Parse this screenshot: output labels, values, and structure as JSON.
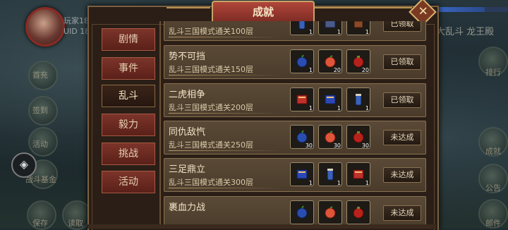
{
  "player": {
    "name": "玩家188",
    "uid": "UID 1881"
  },
  "right_banner": "大乱斗 龙王殿",
  "left_hud": [
    {
      "label": "首充",
      "icon": "first-recharge-icon"
    },
    {
      "label": "签到",
      "icon": "sign-in-icon"
    },
    {
      "label": "活动",
      "icon": "event-icon"
    },
    {
      "label": "战斗基金",
      "icon": "fund-icon"
    },
    {
      "label": "保存",
      "icon": "save-icon"
    },
    {
      "label": "读取",
      "icon": "load-icon"
    }
  ],
  "right_hud": [
    {
      "label": "排行",
      "icon": "ranking-icon"
    },
    {
      "label": "成就",
      "icon": "achievement-icon"
    },
    {
      "label": "公告",
      "icon": "notice-icon"
    },
    {
      "label": "邮件",
      "icon": "mail-icon"
    }
  ],
  "panel": {
    "title": "成就",
    "close": "✕"
  },
  "tabs": [
    {
      "label": "剧情",
      "active": false
    },
    {
      "label": "事件",
      "active": false
    },
    {
      "label": "乱斗",
      "active": true
    },
    {
      "label": "毅力",
      "active": false
    },
    {
      "label": "挑战",
      "active": false
    },
    {
      "label": "活动",
      "active": false
    }
  ],
  "achievements": [
    {
      "name": "",
      "desc": "乱斗三国模式通关100层",
      "status": "已领取",
      "rewards": [
        {
          "type": "scroll",
          "count": "1"
        },
        {
          "type": "box",
          "count": "1"
        },
        {
          "type": "gift",
          "count": "1"
        }
      ]
    },
    {
      "name": "势不可挡",
      "desc": "乱斗三国模式通关150层",
      "status": "已领取",
      "rewards": [
        {
          "type": "blue-fruit",
          "count": "1"
        },
        {
          "type": "peach",
          "count": "20"
        },
        {
          "type": "red-fruit",
          "count": "20"
        }
      ]
    },
    {
      "name": "二虎相争",
      "desc": "乱斗三国模式通关200层",
      "status": "已领取",
      "rewards": [
        {
          "type": "red-book",
          "count": "1"
        },
        {
          "type": "blue-book",
          "count": "1"
        },
        {
          "type": "scroll",
          "count": "1"
        }
      ]
    },
    {
      "name": "同仇敌忾",
      "desc": "乱斗三国模式通关250层",
      "status": "未达成",
      "rewards": [
        {
          "type": "blue-fruit",
          "count": "30"
        },
        {
          "type": "peach",
          "count": "30"
        },
        {
          "type": "red-fruit",
          "count": "30"
        }
      ]
    },
    {
      "name": "三足鼎立",
      "desc": "乱斗三国模式通关300层",
      "status": "未达成",
      "rewards": [
        {
          "type": "blue-book",
          "count": "1"
        },
        {
          "type": "scroll",
          "count": "1"
        },
        {
          "type": "red-book",
          "count": "1"
        }
      ]
    },
    {
      "name": "裹血力战",
      "desc": "",
      "status": "未达成",
      "rewards": [
        {
          "type": "blue-fruit",
          "count": ""
        },
        {
          "type": "peach",
          "count": ""
        },
        {
          "type": "red-fruit",
          "count": ""
        }
      ]
    }
  ],
  "colors": {
    "accent": "#b0463a",
    "panel_bg": "#2a1e16",
    "row_bg": "#4a3b2b",
    "border": "#8a7150"
  }
}
